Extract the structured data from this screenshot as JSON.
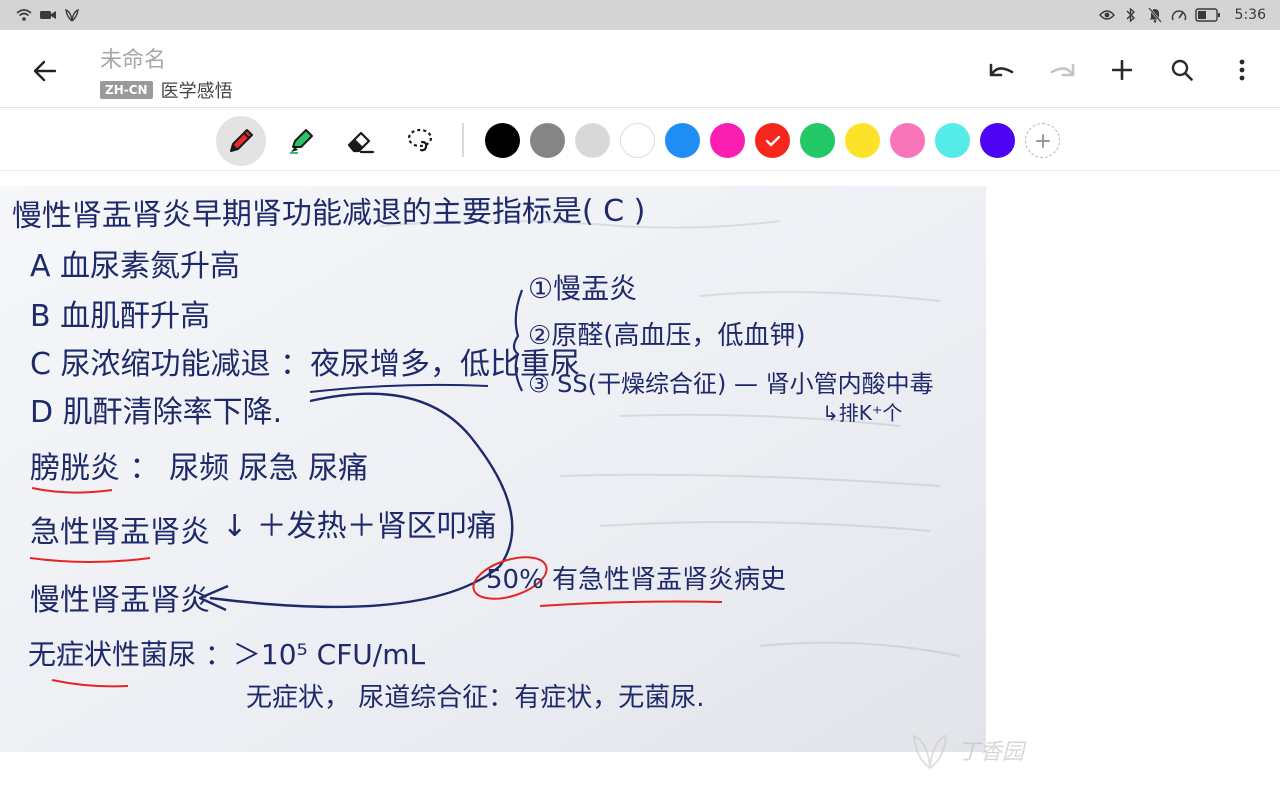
{
  "status_bar": {
    "time": "5:36",
    "left_icons": [
      "wifi-icon",
      "camera-icon",
      "leaf-icon"
    ],
    "right_icons": [
      "eye-icon",
      "bluetooth-icon",
      "bell-off-icon",
      "speed-icon",
      "battery-icon"
    ]
  },
  "header": {
    "title": "未命名",
    "lang_badge": "ZH-CN",
    "notebook": "医学感悟"
  },
  "actions": [
    "undo-icon",
    "redo-icon",
    "add-icon",
    "search-icon",
    "more-icon"
  ],
  "tools": [
    "pen",
    "highlighter",
    "eraser",
    "lasso"
  ],
  "colors": {
    "swatches": [
      "#000000",
      "#858585",
      "#d8d8d8",
      "#ffffff",
      "#1e8ef5",
      "#fb1fb1",
      "#f6261c",
      "#22c966",
      "#fde22a",
      "#f875b9",
      "#55ece8",
      "#4c04f2"
    ],
    "selected": "#f6261c"
  },
  "note": {
    "line1": "慢性肾盂肾炎早期肾功能减退的主要指标是(  C  )",
    "a": "A 血尿素氮升高",
    "b": "B 血肌酐升高",
    "c": "C 尿浓缩功能减退 ：夜尿增多，低比重尿",
    "d": "D 肌酐清除率下降.",
    "r1": "①慢盂炎",
    "r2": "②原醛(高血压，低血钾)",
    "r3": "③ SS(干燥综合征) — 肾小管内酸中毒",
    "r4": "↳排K⁺个",
    "cys": "膀胱炎 ： 尿频 尿急 尿痛",
    "acute": "急性肾盂肾炎",
    "acute_sym": "↓ ＋发热＋肾区叩痛",
    "chronic": "慢性肾盂肾炎",
    "history": "50% 有急性肾盂肾炎病史",
    "asym": "无症状性菌尿 ：＞10⁵ CFU/mL",
    "asym2": "无症状，  尿道综合征：有症状，无菌尿."
  },
  "watermark": "丁香园"
}
